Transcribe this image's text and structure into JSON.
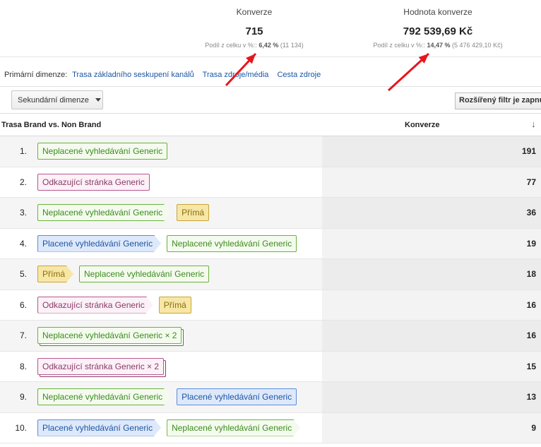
{
  "summary": {
    "conversions": {
      "title": "Konverze",
      "value": "715",
      "pct_prefix": "Podíl z celku v %::",
      "pct": "6,42 %",
      "pct_total": "(11 134)"
    },
    "value": {
      "title": "Hodnota konverze",
      "value": "792 539,69 Kč",
      "pct_prefix": "Podíl z celku v %::",
      "pct": "14,47 %",
      "pct_total": "(5 476 429,10 Kč)"
    }
  },
  "annotations": {
    "arrow_color": "#e8161b"
  },
  "dimensions": {
    "label": "Primární dimenze:",
    "options": [
      "Trasa základního seskupení kanálů",
      "Trasa zdroje/média",
      "Cesta zdroje"
    ]
  },
  "toolbar": {
    "secondary_dimension": "Sekundární dimenze",
    "advanced_filter": "Rozšířený filtr je zapnutý"
  },
  "table": {
    "col_path": "Trasa Brand vs. Non Brand",
    "col_conversions": "Konverze",
    "sort_icon": "↓",
    "rows": [
      {
        "index": "1.",
        "value": "191",
        "steps": [
          {
            "label": "Neplacené vyhledávání Generic",
            "color": "green",
            "arrow": false,
            "stack": false
          }
        ]
      },
      {
        "index": "2.",
        "value": "77",
        "steps": [
          {
            "label": "Odkazující stránka Generic",
            "color": "pink",
            "arrow": false,
            "stack": false
          }
        ]
      },
      {
        "index": "3.",
        "value": "36",
        "steps": [
          {
            "label": "Neplacené vyhledávání Generic",
            "color": "green",
            "arrow": true,
            "stack": false
          },
          {
            "label": "Přímá",
            "color": "yellow",
            "arrow": false,
            "stack": false
          }
        ]
      },
      {
        "index": "4.",
        "value": "19",
        "steps": [
          {
            "label": "Placené vyhledávání Generic",
            "color": "blue",
            "arrow": true,
            "stack": false
          },
          {
            "label": "Neplacené vyhledávání Generic",
            "color": "green",
            "arrow": false,
            "stack": false
          }
        ]
      },
      {
        "index": "5.",
        "value": "18",
        "steps": [
          {
            "label": "Přímá",
            "color": "yellow",
            "arrow": true,
            "stack": false
          },
          {
            "label": "Neplacené vyhledávání Generic",
            "color": "green",
            "arrow": false,
            "stack": false
          }
        ]
      },
      {
        "index": "6.",
        "value": "16",
        "steps": [
          {
            "label": "Odkazující stránka Generic",
            "color": "pink",
            "arrow": true,
            "stack": false
          },
          {
            "label": "Přímá",
            "color": "yellow",
            "arrow": false,
            "stack": false
          }
        ]
      },
      {
        "index": "7.",
        "value": "16",
        "steps": [
          {
            "label": "Neplacené vyhledávání Generic × 2",
            "color": "green",
            "arrow": false,
            "stack": true
          }
        ]
      },
      {
        "index": "8.",
        "value": "15",
        "steps": [
          {
            "label": "Odkazující stránka Generic × 2",
            "color": "pink",
            "arrow": false,
            "stack": true
          }
        ]
      },
      {
        "index": "9.",
        "value": "13",
        "steps": [
          {
            "label": "Neplacené vyhledávání Generic",
            "color": "green",
            "arrow": true,
            "stack": false
          },
          {
            "label": "Placené vyhledávání Generic",
            "color": "blue",
            "arrow": false,
            "stack": false
          }
        ]
      },
      {
        "index": "10.",
        "value": "9",
        "steps": [
          {
            "label": "Placené vyhledávání Generic",
            "color": "blue",
            "arrow": true,
            "stack": false
          },
          {
            "label": "Neplacené vyhledávání Generic",
            "color": "green",
            "arrow": true,
            "stack": false
          }
        ]
      }
    ]
  }
}
